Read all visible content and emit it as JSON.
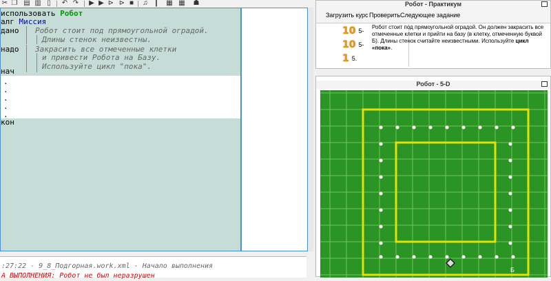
{
  "editor": {
    "lines": [
      {
        "kw": "использовать",
        "mod": "Робот"
      },
      {
        "kw": "алг",
        "alg": "Миссия"
      },
      {
        "kw": "дано",
        "cmt": "Робот стоит под прямоугольной оградой."
      },
      {
        "cmt": "Длины стенок неизвестны."
      },
      {
        "kw": "надо",
        "cmt": "Закрасить все отмеченные клетки"
      },
      {
        "cmt": "и привести Робота на Базу."
      },
      {
        "cmt": "Используйте цикл \"пока\"."
      },
      {
        "kw": "нач"
      },
      {
        "dot": "."
      },
      {
        "dot": "."
      },
      {
        "dot": "."
      },
      {
        "dot": "."
      },
      {
        "dot": "."
      },
      {
        "kw": "кон"
      }
    ]
  },
  "console": {
    "line1": ":27:22 - 9_8_Подгорная.work.xml - Начало выполнения",
    "line2": "А ВЫПОЛНЕНИЯ: Робот не был неразрушен"
  },
  "practicum": {
    "title": "Робот - Практикум",
    "buttons": [
      "Загрузить курс",
      "Проверить",
      "Следующее задание"
    ],
    "tasks": [
      {
        "num": "10",
        "label": "5-"
      },
      {
        "num": "10",
        "label": "5-"
      },
      {
        "num": "1",
        "label": "5."
      }
    ],
    "description_pre": "Робот стоит под прямоугольной оградой. Он должен закрасить все отмеченные клетки и прийти на базу (в клетку, отмеченную буквой Б). Длины стенок считайте неизвестными. Используйте ",
    "description_bold": "цикл «пока»",
    "description_post": "."
  },
  "robot": {
    "title": "Робот - 5-D",
    "base_letter": "Б",
    "colors": {
      "field": "#2a9425",
      "grid": "#74c45c",
      "wall": "#e8e000",
      "mark": "#ffffff"
    }
  }
}
